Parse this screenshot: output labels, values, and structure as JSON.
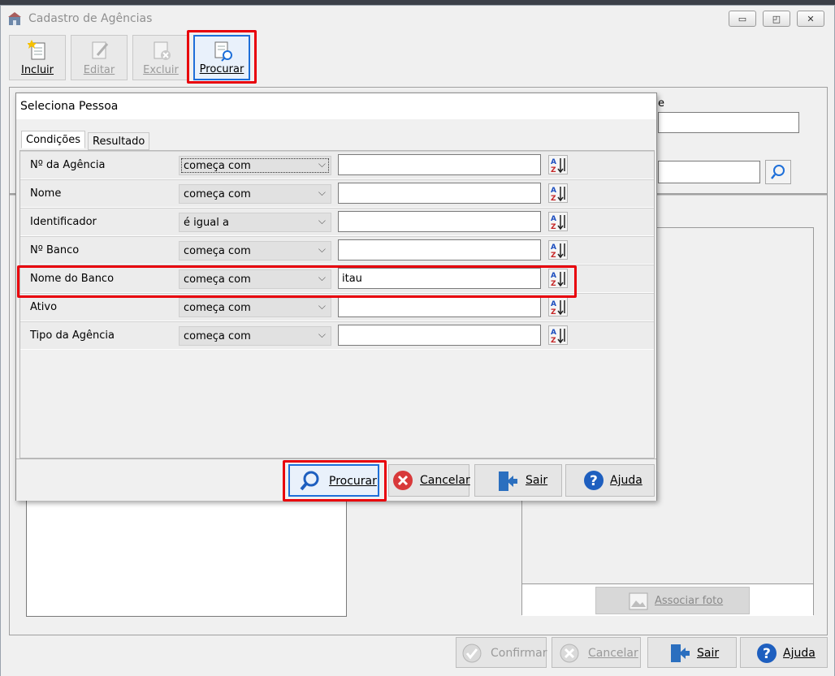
{
  "window": {
    "title": "Cadastro de Agências"
  },
  "toolbar": {
    "incluir": "Incluir",
    "editar": "Editar",
    "excluir": "Excluir",
    "procurar": "Procurar"
  },
  "background": {
    "field_label_fragment": "e",
    "associar_foto": "Associar foto"
  },
  "bottom_bar": {
    "confirmar": "Confirmar",
    "cancelar": "Cancelar",
    "sair": "Sair",
    "ajuda": "Ajuda"
  },
  "dialog": {
    "title": "Seleciona Pessoa",
    "tabs": [
      "Condições",
      "Resultado"
    ],
    "rows": [
      {
        "field": "Nº da Agência",
        "operator": "começa com",
        "value": ""
      },
      {
        "field": "Nome",
        "operator": "começa com",
        "value": ""
      },
      {
        "field": "Identificador",
        "operator": "é igual a",
        "value": ""
      },
      {
        "field": "Nº Banco",
        "operator": "começa com",
        "value": ""
      },
      {
        "field": "Nome do Banco",
        "operator": "começa com",
        "value": "itau"
      },
      {
        "field": "Ativo",
        "operator": "começa com",
        "value": ""
      },
      {
        "field": "Tipo da Agência",
        "operator": "começa com",
        "value": ""
      }
    ],
    "buttons": {
      "procurar": "Procurar",
      "cancelar": "Cancelar",
      "sair": "Sair",
      "ajuda": "Ajuda"
    }
  },
  "colors": {
    "highlight": "#e8000b",
    "accent": "#1e6fd9"
  }
}
